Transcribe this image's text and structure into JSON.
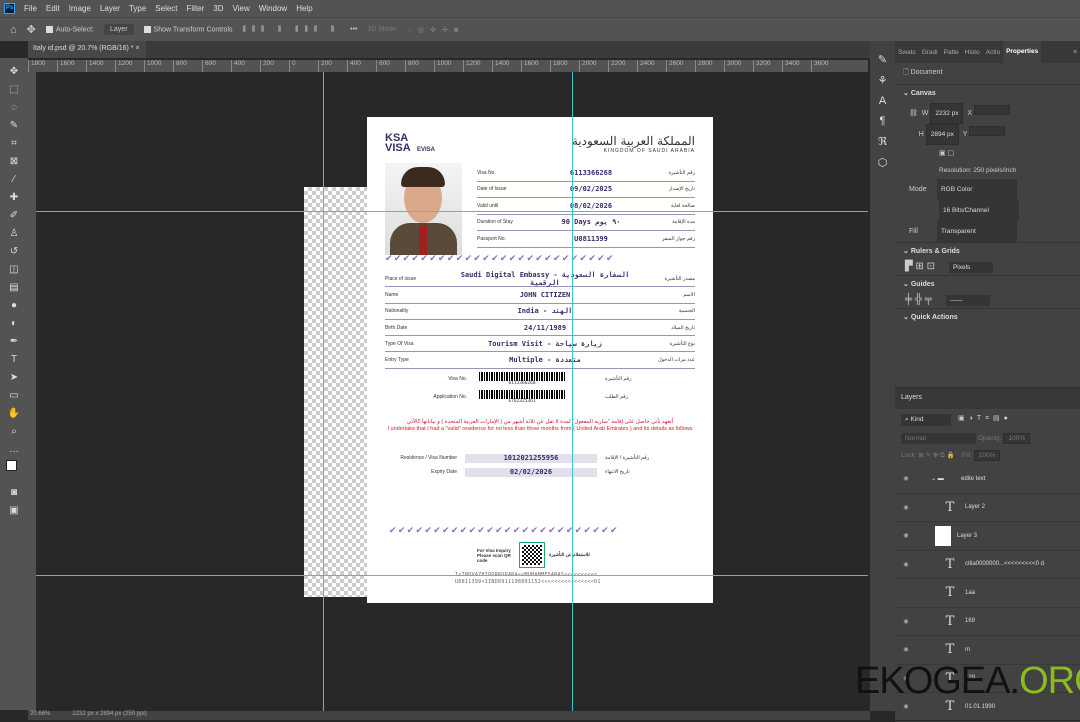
{
  "menu": [
    "File",
    "Edit",
    "Image",
    "Layer",
    "Type",
    "Select",
    "Filter",
    "3D",
    "View",
    "Window",
    "Help"
  ],
  "options": {
    "auto_select": "Auto-Select:",
    "layer_select": "Layer",
    "show_transform": "Show Transform Controls",
    "more": "•••",
    "mode_3d": "3D Mode:"
  },
  "tab": {
    "title": "Italy id.psd @ 20.7% (RGB/16) *",
    "close": "×"
  },
  "ruler": [
    "1800",
    "1600",
    "1400",
    "1200",
    "1000",
    "800",
    "600",
    "400",
    "200",
    "0",
    "200",
    "400",
    "600",
    "800",
    "1000",
    "1200",
    "1400",
    "1600",
    "1800",
    "2000",
    "2200",
    "2400",
    "2600",
    "2800",
    "3000",
    "3200",
    "3400",
    "3600"
  ],
  "document": {
    "ksa": "KSA",
    "visa": "VISA",
    "evisa": "EVISA",
    "kingdom_ar": "المملكة العربية السعودية",
    "kingdom_en": "KINGDOM OF SAUDI ARABIA",
    "top_fields": [
      {
        "label": "Visa No.",
        "value": "6113366268",
        "ar": "رقم التأشيرة"
      },
      {
        "label": "Date of Issue",
        "value": "09/02/2025",
        "ar": "تاريخ الإصدار"
      },
      {
        "label": "Valid until",
        "value": "08/02/2026",
        "ar": "صالحة لغاية"
      },
      {
        "label": "Duration of Stay",
        "value": "90 Days   ٩٠ يوم",
        "ar": "مدة الإقامة"
      },
      {
        "label": "Passport No.",
        "value": "U0811399",
        "ar": "رقم جواز السفر"
      }
    ],
    "checks": "✔✔✔✔✔✔✔✔✔✔✔✔✔✔✔✔✔✔✔✔✔✔✔✔✔✔",
    "mid_fields": [
      {
        "label": "Place of issue",
        "value": "Saudi Digital Embassy - السفارة السعودية الرقمية",
        "ar": "مصدر التأشيرة"
      },
      {
        "label": "Name",
        "value": "JOHN CITIZEN",
        "ar": "الاسم"
      },
      {
        "label": "Nationality",
        "value": "India - الهند",
        "ar": "الجنسية"
      },
      {
        "label": "Birth Date",
        "value": "24/11/1989",
        "ar": "تاريخ الميلاد"
      },
      {
        "label": "Type Of Visa",
        "value": "Tourism Visit - زيارة سياحة",
        "ar": "نوع التأشيرة"
      },
      {
        "label": "Entry Type",
        "value": "Multiple - متعددة",
        "ar": "عدد مرات الدخول"
      }
    ],
    "barcodes": [
      {
        "label": "Visa No.",
        "number": "6113366268",
        "ar": "رقم التأشيرة"
      },
      {
        "label": "Application No.",
        "number": "E762325361",
        "ar": "رقم الطلب"
      }
    ],
    "undertaking_ar": "أتعهد بأني حاصل على إقامة \"سارية المفعول\" لمدة لا تقل عن ثلاثة أشهر من ( الإمارات العربية المتحدة ) و بياناتها كالآتي",
    "undertaking_en": "I undertake that I had a \"valid\" residence for no less than three months from ( United Arab Emirates ) and its details as follows",
    "residence": [
      {
        "label": "Residence / Visa Number",
        "value": "1012021255956",
        "ar": "رقم التأشيرة / الإقامة"
      },
      {
        "label": "Expiry Date",
        "value": "02/02/2026",
        "ar": "تاريخ الانتهاء"
      }
    ],
    "inquiry_en": "For Visa Inquiry Please scan QR code",
    "inquiry_ar": "للاستعلام عن التأشيرة",
    "mrz1": "I<INDVAZHIPORRUPARA<<MUHAMMEDANAS<<<<<<<<<<",
    "mrz2": "U0811399<1IND8911198891152<<<<<<<<<<<<<<<<01"
  },
  "properties": {
    "tabs": [
      "Swatc",
      "Gradi",
      "Patte",
      "Histo",
      "Actio",
      "Properties"
    ],
    "document": "Document",
    "canvas": "Canvas",
    "w_label": "W",
    "w": "2232 px",
    "h_label": "H",
    "h": "2894 px",
    "x_label": "X",
    "y_label": "Y",
    "resolution": "Resolution: 250 pixels/inch",
    "mode_label": "Mode",
    "mode": "RGB Color",
    "depth": "16 Bits/Channel",
    "fill_label": "Fill",
    "fill": "Transparent",
    "rulers": "Rulers & Grids",
    "units": "Pixels",
    "guides": "Guides",
    "quick": "Quick Actions"
  },
  "layers": {
    "title": "Layers",
    "kind": "Kind",
    "blend": "Normal",
    "opacity_label": "Opacity:",
    "opacity": "100%",
    "lock": "Lock:",
    "fill_label": "Fill:",
    "fill": "100%",
    "items": [
      {
        "name": "edite text",
        "type": "group"
      },
      {
        "name": "Layer 2",
        "type": "text"
      },
      {
        "name": "Layer 3",
        "type": "image"
      },
      {
        "name": "citla0000000...<<<<<<<<<0 d",
        "type": "text"
      },
      {
        "name": "1aa",
        "type": "text"
      },
      {
        "name": "169",
        "type": "text"
      },
      {
        "name": "m",
        "type": "text"
      },
      {
        "name": "129",
        "type": "text"
      },
      {
        "name": "01.01.1990",
        "type": "text"
      }
    ]
  },
  "status": {
    "zoom": "20.66%",
    "size": "2232 px x 2894 px (250 ppi)"
  },
  "watermark": {
    "a": "EKOGEA.",
    "b": "ORG"
  }
}
